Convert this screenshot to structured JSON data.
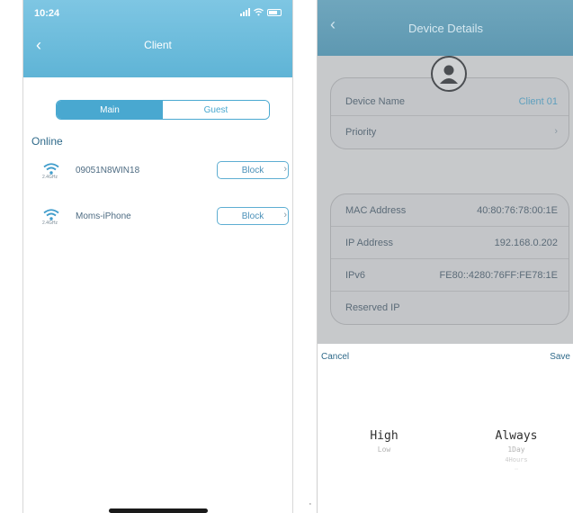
{
  "left": {
    "status": {
      "time": "10:24"
    },
    "header": {
      "title": "Client"
    },
    "tabs": [
      {
        "label": "Main",
        "active": true
      },
      {
        "label": "Guest",
        "active": false
      }
    ],
    "section_label": "Online",
    "clients": [
      {
        "name": "09051N8WIN18",
        "band": "2.4GHz",
        "action": "Block"
      },
      {
        "name": "Moms-iPhone",
        "band": "2.4GHz",
        "action": "Block"
      }
    ]
  },
  "right": {
    "header": {
      "title": "Device Details"
    },
    "card1": [
      {
        "label": "Device Name",
        "value": "Client 01"
      },
      {
        "label": "Priority",
        "value": ""
      }
    ],
    "card2": [
      {
        "label": "MAC Address",
        "value": "40:80:76:78:00:1E"
      },
      {
        "label": "IP Address",
        "value": "192.168.0.202"
      },
      {
        "label": "IPv6",
        "value": "FE80::4280:76FF:FE78:1E"
      },
      {
        "label": "Reserved IP",
        "value": ""
      }
    ],
    "sheet": {
      "cancel": "Cancel",
      "save": "Save",
      "priority_options": [
        "High",
        "Low"
      ],
      "duration_options": [
        "Always",
        "1Day",
        "4Hours"
      ]
    }
  },
  "colors": {
    "accent": "#49a8d0",
    "header": "#5fb4d6",
    "link": "#2f6a8a"
  }
}
